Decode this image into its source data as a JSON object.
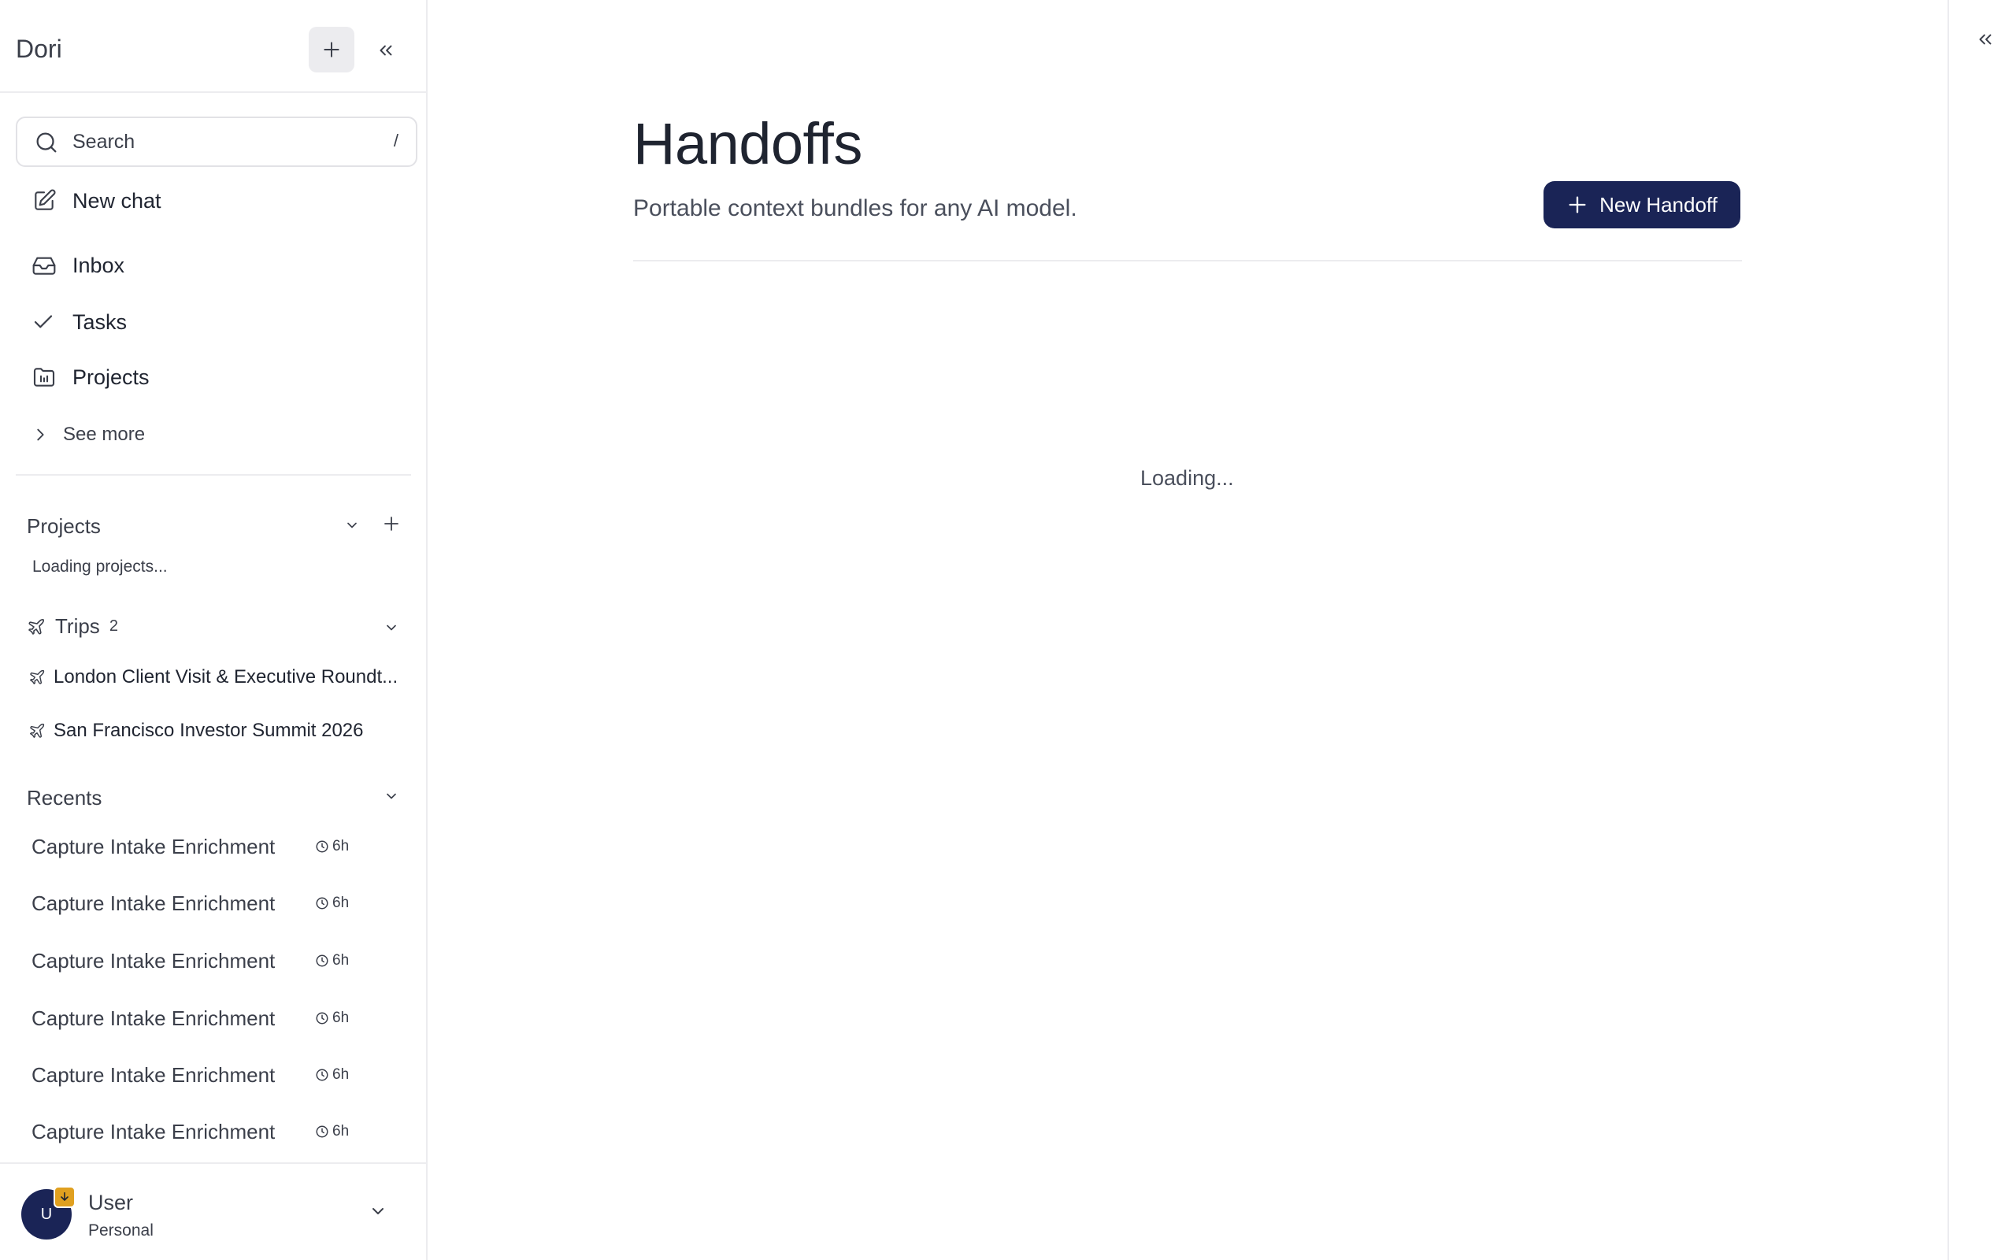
{
  "sidebar": {
    "app_title": "Dori",
    "search": {
      "placeholder": "Search",
      "shortcut": "/"
    },
    "nav": {
      "new_chat": "New chat",
      "inbox": "Inbox",
      "tasks": "Tasks",
      "projects": "Projects",
      "see_more": "See more"
    },
    "projects_section": {
      "title": "Projects",
      "loading_text": "Loading projects..."
    },
    "trips_section": {
      "title": "Trips",
      "count": "2",
      "items": [
        {
          "label": "London Client Visit & Executive Roundt..."
        },
        {
          "label": "San Francisco Investor Summit 2026"
        }
      ]
    },
    "recents_section": {
      "title": "Recents",
      "items": [
        {
          "label": "Capture Intake Enrichment",
          "time": "6h"
        },
        {
          "label": "Capture Intake Enrichment",
          "time": "6h"
        },
        {
          "label": "Capture Intake Enrichment",
          "time": "6h"
        },
        {
          "label": "Capture Intake Enrichment",
          "time": "6h"
        },
        {
          "label": "Capture Intake Enrichment",
          "time": "6h"
        },
        {
          "label": "Capture Intake Enrichment",
          "time": "6h"
        }
      ]
    },
    "user": {
      "avatar_initial": "U",
      "name": "User",
      "plan": "Personal"
    }
  },
  "main": {
    "title": "Handoffs",
    "subtitle": "Portable context bundles for any AI model.",
    "new_button_label": "New Handoff",
    "loading_text": "Loading..."
  },
  "colors": {
    "accent": "#1a2456",
    "badge": "#e0a020",
    "border": "#ececef",
    "text_primary": "#1f2430",
    "text_secondary": "#3b3f4a"
  }
}
